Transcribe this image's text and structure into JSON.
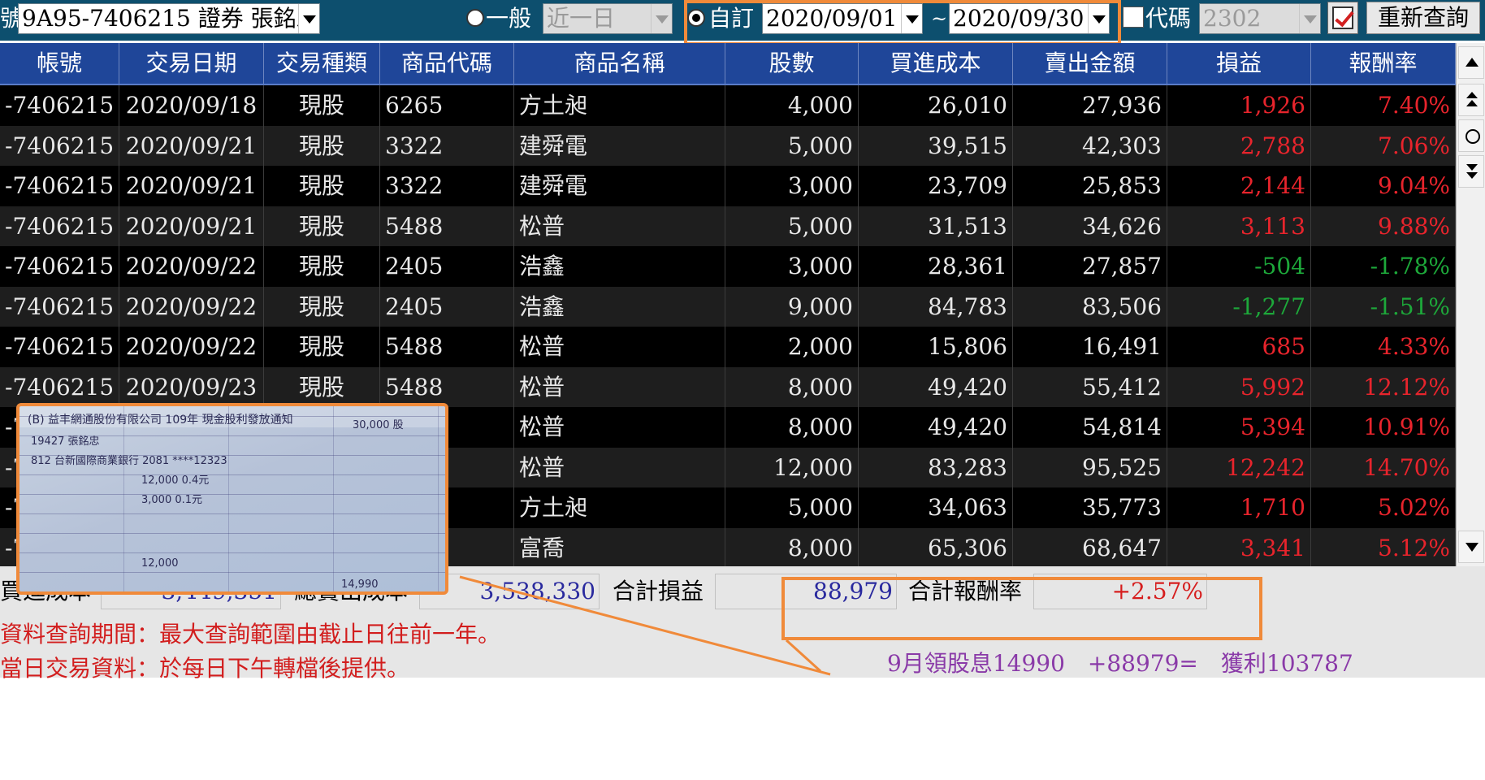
{
  "toolbar": {
    "account_label_partial": "號",
    "account_value": "9A95-7406215  證券  張銘忠",
    "radio_general_label": "一般",
    "period_value": "近一日",
    "radio_custom_label": "自訂",
    "date_from": "2020/09/01",
    "date_tilde": "~",
    "date_to": "2020/09/30",
    "code_label": "代碼",
    "code_value": "2302",
    "requery_label": "重新查詢"
  },
  "table": {
    "headers": [
      "帳號",
      "交易日期",
      "交易種類",
      "商品代碼",
      "商品名稱",
      "股數",
      "買進成本",
      "賣出金額",
      "損益",
      "報酬率"
    ],
    "rows": [
      {
        "account": "-7406215",
        "date": "2020/09/18",
        "type": "現股",
        "code": "6265",
        "name": "方土昶",
        "shares": "4,000",
        "cost": "26,010",
        "sell": "27,936",
        "pnl": "1,926",
        "ret": "7.40%",
        "sign": "pos"
      },
      {
        "account": "-7406215",
        "date": "2020/09/21",
        "type": "現股",
        "code": "3322",
        "name": "建舜電",
        "shares": "5,000",
        "cost": "39,515",
        "sell": "42,303",
        "pnl": "2,788",
        "ret": "7.06%",
        "sign": "pos"
      },
      {
        "account": "-7406215",
        "date": "2020/09/21",
        "type": "現股",
        "code": "3322",
        "name": "建舜電",
        "shares": "3,000",
        "cost": "23,709",
        "sell": "25,853",
        "pnl": "2,144",
        "ret": "9.04%",
        "sign": "pos"
      },
      {
        "account": "-7406215",
        "date": "2020/09/21",
        "type": "現股",
        "code": "5488",
        "name": "松普",
        "shares": "5,000",
        "cost": "31,513",
        "sell": "34,626",
        "pnl": "3,113",
        "ret": "9.88%",
        "sign": "pos"
      },
      {
        "account": "-7406215",
        "date": "2020/09/22",
        "type": "現股",
        "code": "2405",
        "name": "浩鑫",
        "shares": "3,000",
        "cost": "28,361",
        "sell": "27,857",
        "pnl": "-504",
        "ret": "-1.78%",
        "sign": "neg"
      },
      {
        "account": "-7406215",
        "date": "2020/09/22",
        "type": "現股",
        "code": "2405",
        "name": "浩鑫",
        "shares": "9,000",
        "cost": "84,783",
        "sell": "83,506",
        "pnl": "-1,277",
        "ret": "-1.51%",
        "sign": "neg"
      },
      {
        "account": "-7406215",
        "date": "2020/09/22",
        "type": "現股",
        "code": "5488",
        "name": "松普",
        "shares": "2,000",
        "cost": "15,806",
        "sell": "16,491",
        "pnl": "685",
        "ret": "4.33%",
        "sign": "pos"
      },
      {
        "account": "-7406215",
        "date": "2020/09/23",
        "type": "現股",
        "code": "5488",
        "name": "松普",
        "shares": "8,000",
        "cost": "49,420",
        "sell": "55,412",
        "pnl": "5,992",
        "ret": "12.12%",
        "sign": "pos"
      },
      {
        "account": "-7",
        "date": "",
        "type": "",
        "code": "",
        "name": "松普",
        "shares": "8,000",
        "cost": "49,420",
        "sell": "54,814",
        "pnl": "5,394",
        "ret": "10.91%",
        "sign": "pos"
      },
      {
        "account": "-7",
        "date": "",
        "type": "",
        "code": "",
        "name": "松普",
        "shares": "12,000",
        "cost": "83,283",
        "sell": "95,525",
        "pnl": "12,242",
        "ret": "14.70%",
        "sign": "pos"
      },
      {
        "account": "-7",
        "date": "",
        "type": "",
        "code": "",
        "name": "方土昶",
        "shares": "5,000",
        "cost": "34,063",
        "sell": "35,773",
        "pnl": "1,710",
        "ret": "5.02%",
        "sign": "pos"
      },
      {
        "account": "-7",
        "date": "",
        "type": "",
        "code": "",
        "name": "富喬",
        "shares": "8,000",
        "cost": "65,306",
        "sell": "68,647",
        "pnl": "3,341",
        "ret": "5.12%",
        "sign": "pos"
      }
    ]
  },
  "summary": {
    "buy_cost_label": "買進成本",
    "buy_cost_value": "3,449,351",
    "total_sell_label": "總賣出成本",
    "total_sell_value": "3,538,330",
    "total_pnl_label": "合計損益",
    "total_pnl_value": "88,979",
    "total_return_label": "合計報酬率",
    "total_return_value": "+2.57%",
    "note_period": "資料查詢期間：最大查詢範圍由截止日往前一年。",
    "note_daily": "當日交易資料：於每日下午轉檔後提供。",
    "dividend_note": "9月領股息14990　+88979=　獲利103787"
  },
  "receipt": {
    "line1": "(B) 益丰網通股份有限公司  109年  現金股利發放通知",
    "line2": "19427  張銘忠",
    "line3": "812 台新國際商業銀行 2081 ****12323",
    "line4": "30,000 股",
    "line5": "12,000   0.4元",
    "line6": "3,000    0.1元",
    "line7": "12,000",
    "line8": "14,990"
  },
  "colors": {
    "toolbar_bg": "#0d4f6e",
    "header_bg": "#1f4699",
    "positive": "#e8242c",
    "negative": "#1da83a",
    "highlight": "#f08a3a"
  }
}
